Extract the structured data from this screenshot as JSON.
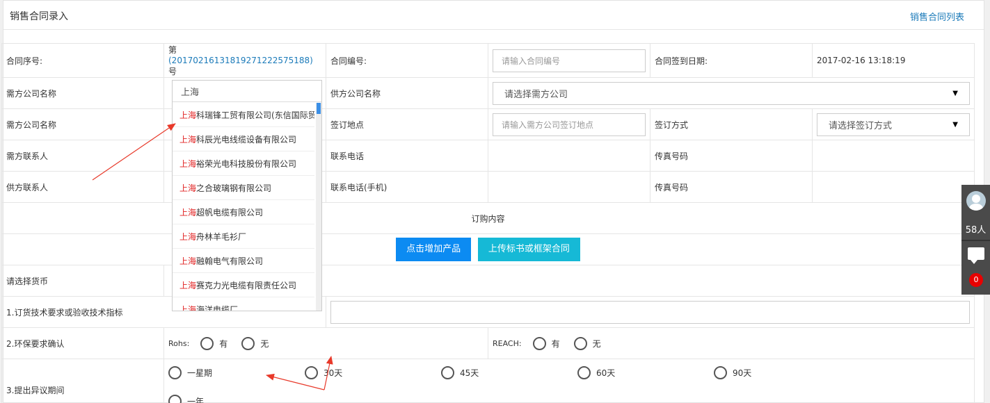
{
  "header": {
    "title": "销售合同录入",
    "list_link": "销售合同列表"
  },
  "row1": {
    "seq_label": "合同序号:",
    "seq_prefix": "第",
    "seq_number": "(20170216131819271222575188)",
    "seq_suffix": "号",
    "contract_no_label": "合同编号:",
    "contract_no_placeholder": "请输入合同编号",
    "sign_date_label": "合同签到日期:",
    "sign_date_value": "2017-02-16 13:18:19"
  },
  "row2": {
    "buyer_label": "需方公司名称",
    "supplier_label": "供方公司名称",
    "supplier_select": "请选择需方公司"
  },
  "row3": {
    "buyer_label": "需方公司名称",
    "place_label": "签订地点",
    "place_placeholder": "请输入需方公司签订地点",
    "method_label": "签订方式",
    "method_select": "请选择签订方式"
  },
  "row4": {
    "buyer_contact_label": "需方联系人",
    "phone_label": "联系电话",
    "fax_label": "传真号码"
  },
  "row5": {
    "supplier_contact_label": "供方联系人",
    "mobile_label": "联系电话(手机)",
    "fax_label": "传真号码"
  },
  "order": {
    "title": "订购内容",
    "add_product_button": "点击增加产品",
    "upload_button": "上传标书或框架合同"
  },
  "currency": {
    "label": "请选择货币"
  },
  "tech": {
    "label": "1.订货技术要求或验收技术指标"
  },
  "env": {
    "label": "2.环保要求确认",
    "rohs_label": "Rohs:",
    "rohs_yes": "有",
    "rohs_no": "无",
    "reach_label": "REACH:",
    "reach_yes": "有",
    "reach_no": "无"
  },
  "objection": {
    "label": "3.提出异议期间",
    "options": [
      "一星期",
      "30天",
      "45天",
      "60天",
      "90天",
      "一年"
    ]
  },
  "dropdown": {
    "search_value": "上海",
    "highlight": "上海",
    "items": [
      "科瑞锋工贸有限公司(东信国际贸",
      "科辰光电线缆设备有限公司",
      "裕荣光电科技股份有限公司",
      "之合玻璃钢有限公司",
      "超帆电缆有限公司",
      "舟林羊毛衫厂",
      "融翰电气有限公司",
      "赛克力光电缆有限责任公司",
      "海洋电缆厂"
    ]
  },
  "side": {
    "online_count": "58人",
    "message_count": "0"
  }
}
